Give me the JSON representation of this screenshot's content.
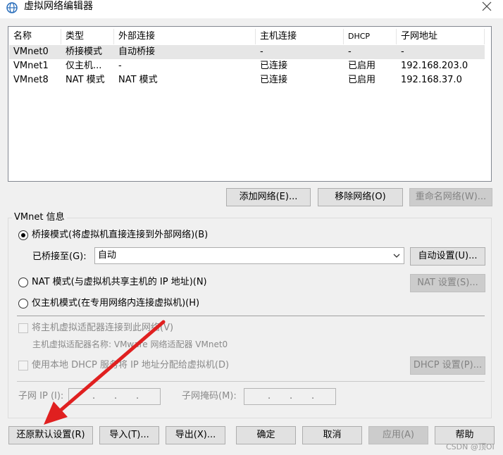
{
  "window": {
    "title": "虚拟网络编辑器"
  },
  "table": {
    "headers": [
      "名称",
      "类型",
      "外部连接",
      "主机连接",
      "DHCP",
      "子网地址"
    ],
    "rows": [
      [
        "VMnet0",
        "桥接模式",
        "自动桥接",
        "-",
        "-",
        "-"
      ],
      [
        "VMnet1",
        "仅主机...",
        "-",
        "已连接",
        "已启用",
        "192.168.203.0"
      ],
      [
        "VMnet8",
        "NAT 模式",
        "NAT 模式",
        "已连接",
        "已启用",
        "192.168.37.0"
      ]
    ],
    "selected_row": 0
  },
  "network_buttons": {
    "add": "添加网络(E)...",
    "remove": "移除网络(O)",
    "rename": "重命名网络(W)..."
  },
  "vmnet_info": {
    "legend": "VMnet 信息",
    "bridged_radio": "桥接模式(将虚拟机直接连接到外部网络)(B)",
    "bridged_to_label": "已桥接至(G):",
    "bridged_to_value": "自动",
    "auto_settings": "自动设置(U)...",
    "nat_radio": "NAT 模式(与虚拟机共享主机的 IP 地址)(N)",
    "nat_settings": "NAT 设置(S)...",
    "hostonly_radio": "仅主机模式(在专用网络内连接虚拟机)(H)",
    "connect_adapter_check": "将主机虚拟适配器连接到此网络(V)",
    "adapter_name": "主机虚拟适配器名称: VMware 网络适配器 VMnet0",
    "dhcp_check": "使用本地 DHCP 服务将 IP 地址分配给虚拟机(D)",
    "dhcp_settings": "DHCP 设置(P)...",
    "subnet_ip_label": "子网 IP (I):",
    "subnet_mask_label": "子网掩码(M):",
    "selected_mode": "bridged"
  },
  "footer": {
    "restore": "还原默认设置(R)",
    "import": "导入(T)...",
    "export": "导出(X)...",
    "ok": "确定",
    "cancel": "取消",
    "apply": "应用(A)",
    "help": "帮助"
  },
  "watermark": "CSDN @顶OI",
  "colors": {
    "annotation_arrow": "#e02020",
    "window_bg": "#f0f0f0"
  }
}
